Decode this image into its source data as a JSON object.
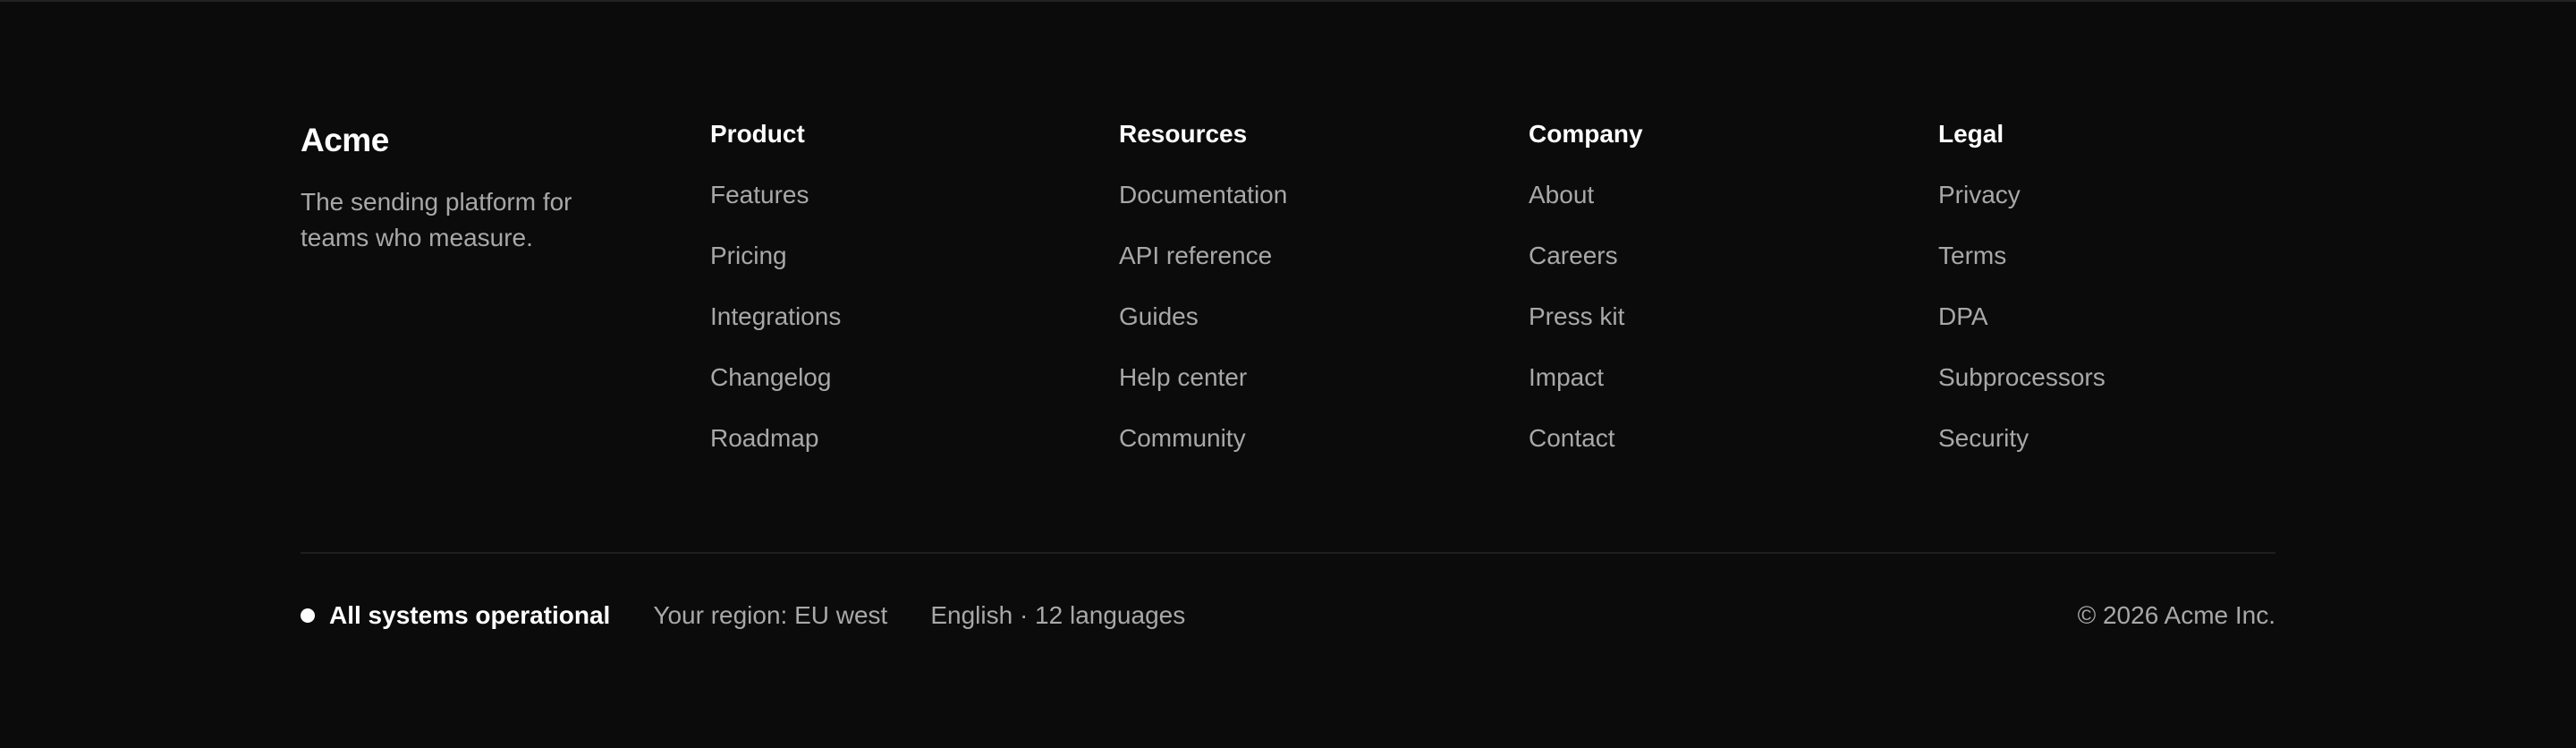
{
  "brand": {
    "name": "Acme",
    "tagline": "The sending platform for teams who measure."
  },
  "columns": [
    {
      "heading": "Product",
      "links": [
        "Features",
        "Pricing",
        "Integrations",
        "Changelog",
        "Roadmap"
      ]
    },
    {
      "heading": "Resources",
      "links": [
        "Documentation",
        "API reference",
        "Guides",
        "Help center",
        "Community"
      ]
    },
    {
      "heading": "Company",
      "links": [
        "About",
        "Careers",
        "Press kit",
        "Impact",
        "Contact"
      ]
    },
    {
      "heading": "Legal",
      "links": [
        "Privacy",
        "Terms",
        "DPA",
        "Subprocessors",
        "Security"
      ]
    }
  ],
  "bottom": {
    "status": "All systems operational",
    "region": "Your region: EU west",
    "language": "English · 12 languages",
    "copyright": "© 2026 Acme Inc."
  },
  "colors": {
    "background": "#0b0b0b",
    "heading": "#ffffff",
    "link": "#a8a8a8",
    "divider": "#1f1f1f",
    "status_dot": "#ffffff"
  }
}
